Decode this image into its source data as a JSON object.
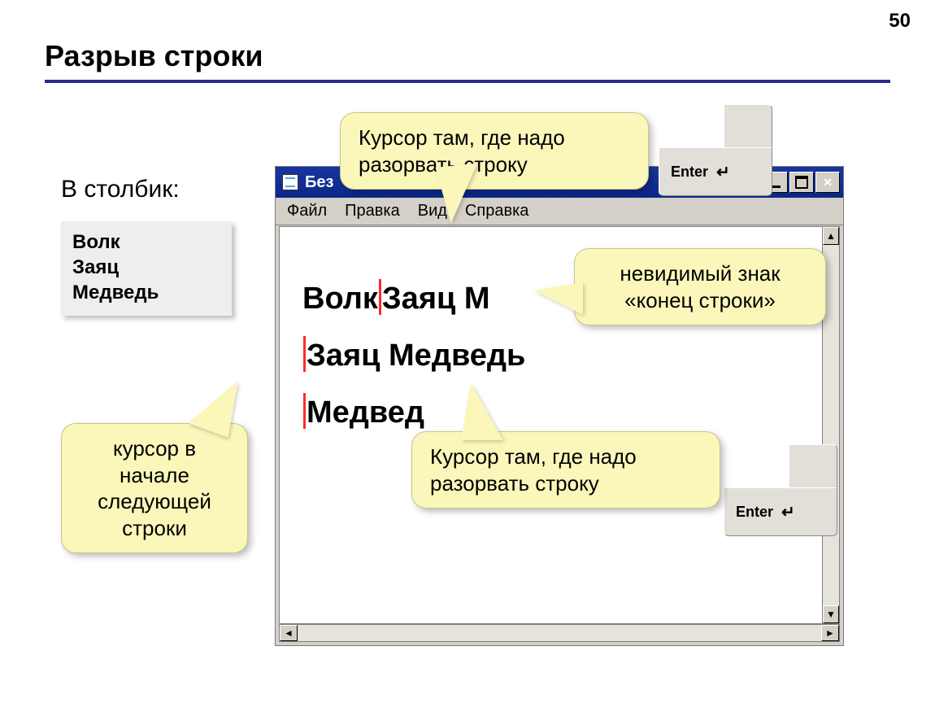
{
  "page_number": "50",
  "title": "Разрыв строки",
  "column_label": "В столбик:",
  "column_items": [
    "Волк",
    "Заяц",
    "Медведь"
  ],
  "window": {
    "title_visible": "Без",
    "menus": [
      "Файл",
      "Правка",
      "Вид",
      "Справка"
    ],
    "lines": {
      "l1_before": "Волк",
      "l1_after": "Заяц М",
      "l2": "Заяц Медведь",
      "l3": "Медвед"
    }
  },
  "callouts": {
    "top": "Курсор там, где надо разорвать строку",
    "right": "невидимый знак «конец строки»",
    "bottom": "Курсор там, где надо разорвать строку",
    "left": "курсор в начале следующей строки"
  },
  "key_label": "Enter"
}
